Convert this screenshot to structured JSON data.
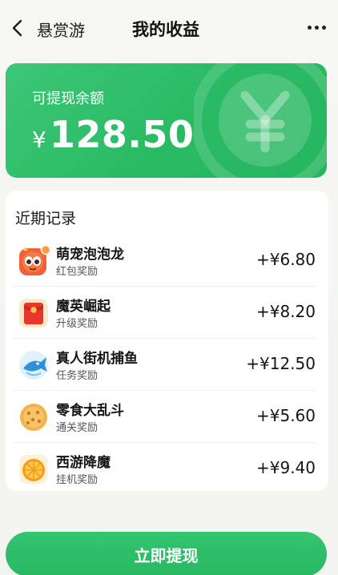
{
  "header": {
    "back_label": "悬赏游",
    "title": "我的收益",
    "more_icon": "more-dots-icon"
  },
  "balance": {
    "label": "可提现余额",
    "currency": "¥",
    "amount": "128.50",
    "deco_icon": "yen-coin-icon"
  },
  "records": {
    "title": "近期记录",
    "items": [
      {
        "name": "萌宠泡泡龙",
        "desc": "红包奖励",
        "amount": "+¥6.80",
        "icon": "dragon-pet-icon"
      },
      {
        "name": "魔英崛起",
        "desc": "升级奖励",
        "amount": "+¥8.20",
        "icon": "red-envelope-icon"
      },
      {
        "name": "真人街机捕鱼",
        "desc": "任务奖励",
        "amount": "+¥12.50",
        "icon": "fish-icon"
      },
      {
        "name": "零食大乱斗",
        "desc": "通关奖励",
        "amount": "+¥5.60",
        "icon": "cookie-icon"
      },
      {
        "name": "西游降魔",
        "desc": "挂机奖励",
        "amount": "+¥9.40",
        "icon": "orange-slice-icon"
      }
    ]
  },
  "actions": {
    "withdraw_label": "立即提现"
  },
  "colors": {
    "accent": "#2bbb65",
    "background": "#f4f5f1"
  }
}
